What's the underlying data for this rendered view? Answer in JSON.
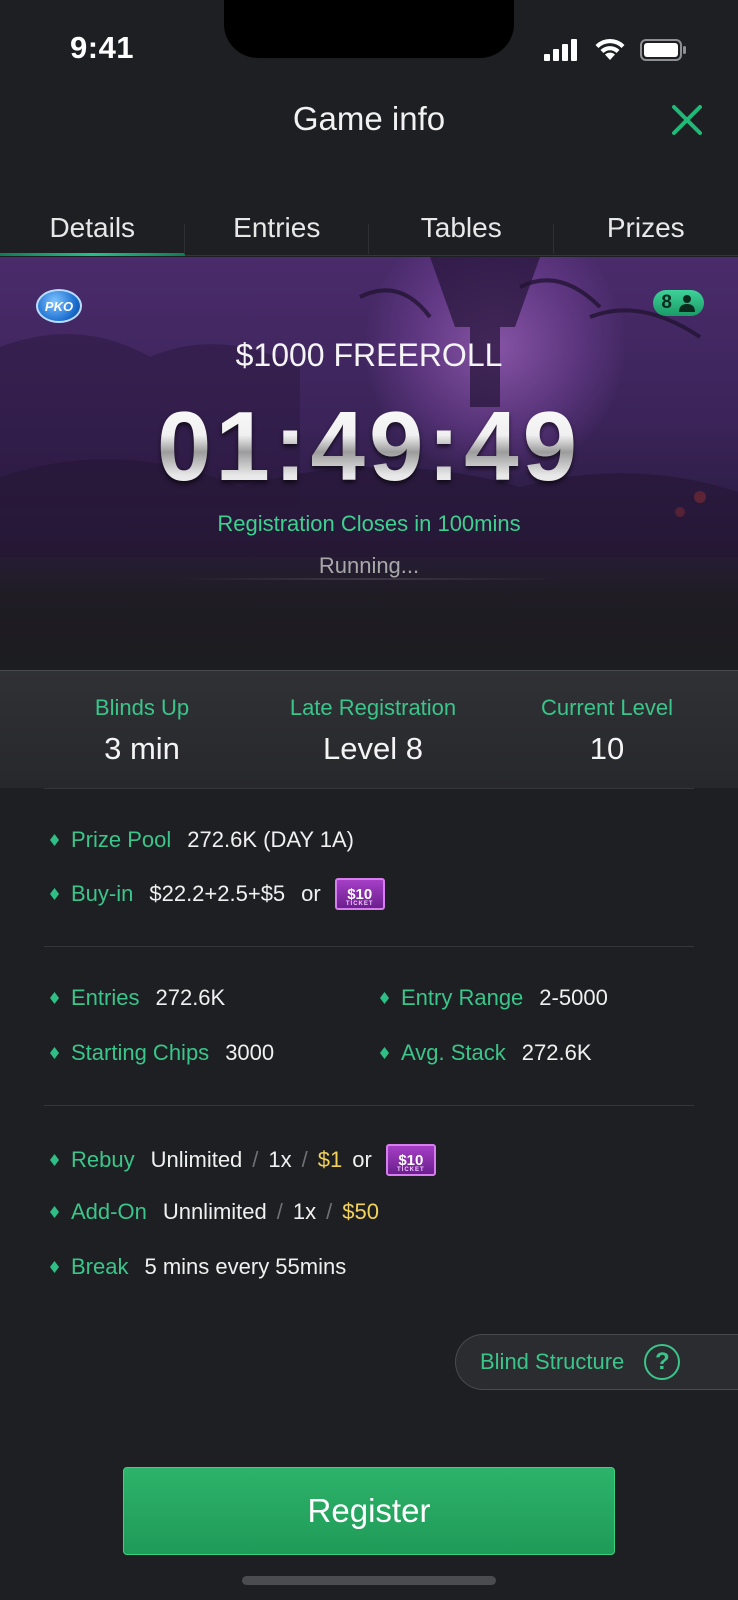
{
  "status_bar": {
    "time": "9:41"
  },
  "header": {
    "title": "Game info"
  },
  "tabs": [
    {
      "label": "Details",
      "active": true
    },
    {
      "label": "Entries",
      "active": false
    },
    {
      "label": "Tables",
      "active": false
    },
    {
      "label": "Prizes",
      "active": false
    }
  ],
  "hero": {
    "badge": "PKO",
    "players_count": "8",
    "title": "$1000 FREEROLL",
    "countdown": "01:49:49",
    "registration_closes": "Registration Closes in 100mins",
    "status": "Running..."
  },
  "summary": {
    "blinds_up": {
      "label": "Blinds Up",
      "value": "3 min"
    },
    "late_registration": {
      "label": "Late Registration",
      "value": "Level 8"
    },
    "current_level": {
      "label": "Current Level",
      "value": "10"
    }
  },
  "details": {
    "prize_pool": {
      "label": "Prize Pool",
      "value": "272.6K (DAY 1A)"
    },
    "buy_in": {
      "label": "Buy-in",
      "value": "$22.2+2.5+$5",
      "or": "or",
      "ticket": "$10"
    },
    "entries": {
      "label": "Entries",
      "value": "272.6K"
    },
    "entry_range": {
      "label": "Entry Range",
      "value": "2-5000"
    },
    "starting_chips": {
      "label": "Starting Chips",
      "value": "3000"
    },
    "avg_stack": {
      "label": "Avg. Stack",
      "value": "272.6K"
    },
    "rebuy": {
      "label": "Rebuy",
      "limit": "Unlimited",
      "times": "1x",
      "price": "$1",
      "or": "or",
      "ticket": "$10",
      "sep": "/"
    },
    "add_on": {
      "label": "Add-On",
      "limit": "Unnlimited",
      "times": "1x",
      "price": "$50",
      "sep": "/"
    },
    "break": {
      "label": "Break",
      "value": "5 mins every 55mins"
    }
  },
  "blind_structure": {
    "label": "Blind Structure",
    "help": "?"
  },
  "register": {
    "label": "Register"
  },
  "colors": {
    "accent_green": "#3ac58a",
    "gold": "#f2d25a",
    "register_green": "#2db36a"
  }
}
